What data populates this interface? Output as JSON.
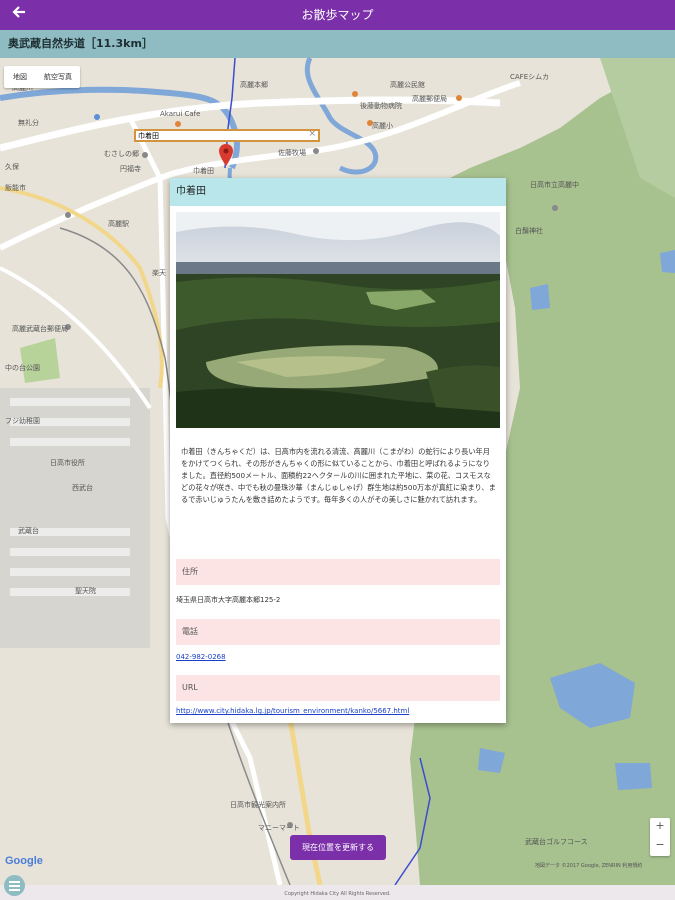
{
  "header": {
    "title": "お散歩マップ",
    "back_icon": "arrow-left-icon"
  },
  "route": {
    "label": "奥武蔵自然歩道［11.3km］"
  },
  "map": {
    "type_buttons": [
      "地図",
      "航空写真"
    ],
    "search_value": "巾着田",
    "labels": {
      "l1": "高麗川",
      "l2": "Akarui Cafe",
      "l3": "高麗本郷",
      "l4": "高麗公民館",
      "l5": "CAFEシムカ",
      "l6": "後藤動物病院",
      "l7": "高麗郵便局",
      "l8": "無礼分",
      "l9": "高麗小",
      "l10": "佐藤牧場",
      "l11": "むさしの郷",
      "l12": "円福寺",
      "l13": "巾着田",
      "l14": "日高市立高麗中",
      "l15": "白鬚神社",
      "l16": "高麗駅",
      "l17": "高麗武蔵台郵便局",
      "l18": "中の台公園",
      "l19": "フジ幼稚園",
      "l20": "西武台",
      "l21": "武蔵台",
      "l22": "聖天院",
      "l23": "日高市観光案内所",
      "l24": "マニーマート",
      "l25": "武蔵台ゴルフコース",
      "l26": "久保",
      "l27": "飯能市",
      "l28": "楽天",
      "l29": "日高市役所"
    },
    "credit": "地図データ ©2017 Google, ZENRIN 利用規約",
    "google": "Google"
  },
  "panel": {
    "title": "巾着田",
    "description": "巾着田（きんちゃくだ）は、日高市内を流れる清流、高麗川（こまがわ）の蛇行により長い年月をかけてつくられ、その形がきんちゃくの形に似ていることから、巾着田と呼ばれるようになりました。直径約500メートル、面積約22ヘクタールの川に囲まれた平地に、菜の花、コスモスなどの花々が咲き、中でも秋の曼珠沙華（まんじゅしゃげ）群生地は約500万本が真紅に染まり、まるで赤いじゅうたんを敷き詰めたようです。毎年多くの人がその美しさに魅かれて訪れます。",
    "address_label": "住所",
    "address": "埼玉県日高市大字高麗本郷125-2",
    "phone_label": "電話",
    "phone": "042-982-0268",
    "url_label": "URL",
    "url": "http://www.city.hidaka.lg.jp/tourism_environment/kanko/5667.html"
  },
  "controls": {
    "update_location": "現在位置を更新する",
    "zoom_in": "+",
    "zoom_out": "−"
  },
  "footer": {
    "copyright": "Copyright Hidaka City All Rights Reserved."
  },
  "colors": {
    "brand": "#7b2fa8",
    "route_bar": "#8fbcc2",
    "panel_header": "#b8e6ea",
    "section_bg": "#fde4e4",
    "link": "#1a3fc8"
  }
}
